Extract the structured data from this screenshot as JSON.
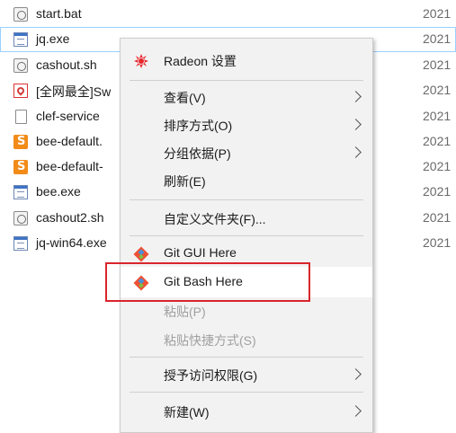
{
  "files": [
    {
      "name": "start.bat",
      "icon": "batch-gear-icon",
      "date": "2021",
      "selected": false
    },
    {
      "name": "jq.exe",
      "icon": "exe-icon",
      "date": "2021",
      "selected": true
    },
    {
      "name": "cashout.sh",
      "icon": "script-gear-icon",
      "date": "2021",
      "selected": false
    },
    {
      "name": "[全网最全]Sw",
      "icon": "pdf-icon",
      "date": "2021",
      "selected": false
    },
    {
      "name": "clef-service",
      "icon": "document-icon",
      "date": "2021",
      "selected": false
    },
    {
      "name": "bee-default.",
      "icon": "sublime-icon",
      "date": "2021",
      "selected": false
    },
    {
      "name": "bee-default-",
      "icon": "sublime-icon",
      "date": "2021",
      "selected": false
    },
    {
      "name": "bee.exe",
      "icon": "exe-icon",
      "date": "2021",
      "selected": false
    },
    {
      "name": "cashout2.sh",
      "icon": "script-gear-icon",
      "date": "2021",
      "selected": false
    },
    {
      "name": "jq-win64.exe",
      "icon": "exe-icon",
      "date": "2021",
      "selected": false
    }
  ],
  "menu": {
    "items": [
      {
        "label": "Radeon 设置",
        "icon": "radeon-icon",
        "submenu": false,
        "disabled": false
      },
      {
        "label": "查看(V)",
        "submenu": true,
        "disabled": false
      },
      {
        "label": "排序方式(O)",
        "submenu": true,
        "disabled": false
      },
      {
        "label": "分组依据(P)",
        "submenu": true,
        "disabled": false
      },
      {
        "label": "刷新(E)",
        "submenu": false,
        "disabled": false
      },
      {
        "label": "自定义文件夹(F)...",
        "submenu": false,
        "disabled": false
      },
      {
        "label": "Git GUI Here",
        "icon": "git-gui-icon",
        "submenu": false,
        "disabled": false
      },
      {
        "label": "Git Bash Here",
        "icon": "git-bash-icon",
        "submenu": false,
        "disabled": false,
        "hovered": true
      },
      {
        "label": "粘贴(P)",
        "submenu": false,
        "disabled": true
      },
      {
        "label": "粘贴快捷方式(S)",
        "submenu": false,
        "disabled": true
      },
      {
        "label": "授予访问权限(G)",
        "submenu": true,
        "disabled": false
      },
      {
        "label": "新建(W)",
        "submenu": true,
        "disabled": false
      }
    ]
  },
  "colors": {
    "highlight_box": "#d9252b",
    "menu_background": "#f2f2f2",
    "hover_background": "#ffffff",
    "radeon_red": "#e8262c",
    "git_orange": "#f05033"
  }
}
